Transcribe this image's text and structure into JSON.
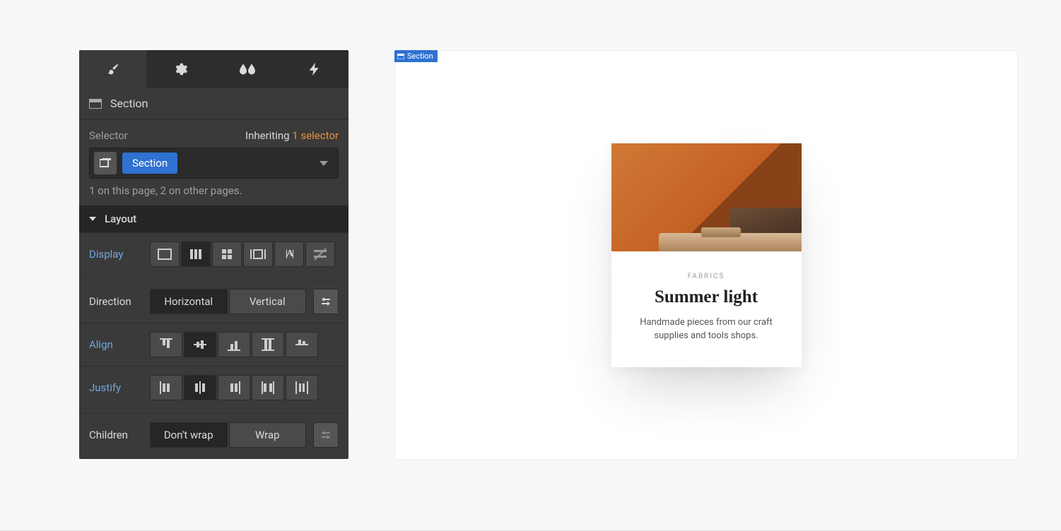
{
  "panel": {
    "crumb": {
      "label": "Section"
    },
    "selector": {
      "label": "Selector",
      "inheriting": "Inheriting ",
      "count_text": "1 selector",
      "chip": "Section",
      "meta": "1 on this page, 2 on other pages."
    },
    "layout": {
      "title": "Layout",
      "display_label": "Display",
      "direction": {
        "label": "Direction",
        "horizontal": "Horizontal",
        "vertical": "Vertical"
      },
      "align_label": "Align",
      "justify_label": "Justify",
      "children": {
        "label": "Children",
        "nowrap": "Don't wrap",
        "wrap": "Wrap"
      }
    }
  },
  "canvas": {
    "sel_label": "Section",
    "card": {
      "eyebrow": "FABRICS",
      "title": "Summer light",
      "desc": "Handmade pieces from our craft supplies and tools shops."
    }
  }
}
